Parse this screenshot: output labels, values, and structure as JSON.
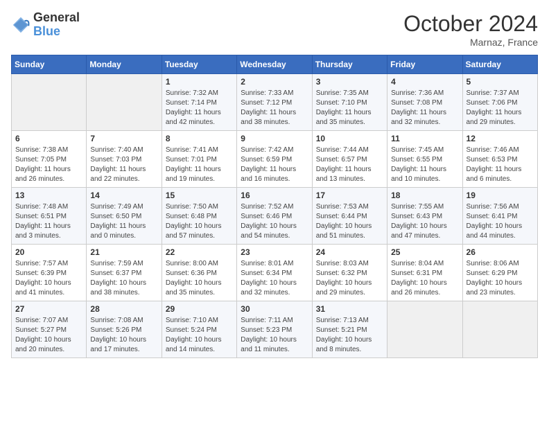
{
  "header": {
    "logo_line1": "General",
    "logo_line2": "Blue",
    "month_title": "October 2024",
    "subtitle": "Marnaz, France"
  },
  "days_of_week": [
    "Sunday",
    "Monday",
    "Tuesday",
    "Wednesday",
    "Thursday",
    "Friday",
    "Saturday"
  ],
  "weeks": [
    [
      {
        "day": "",
        "content": ""
      },
      {
        "day": "",
        "content": ""
      },
      {
        "day": "1",
        "content": "Sunrise: 7:32 AM\nSunset: 7:14 PM\nDaylight: 11 hours and 42 minutes."
      },
      {
        "day": "2",
        "content": "Sunrise: 7:33 AM\nSunset: 7:12 PM\nDaylight: 11 hours and 38 minutes."
      },
      {
        "day": "3",
        "content": "Sunrise: 7:35 AM\nSunset: 7:10 PM\nDaylight: 11 hours and 35 minutes."
      },
      {
        "day": "4",
        "content": "Sunrise: 7:36 AM\nSunset: 7:08 PM\nDaylight: 11 hours and 32 minutes."
      },
      {
        "day": "5",
        "content": "Sunrise: 7:37 AM\nSunset: 7:06 PM\nDaylight: 11 hours and 29 minutes."
      }
    ],
    [
      {
        "day": "6",
        "content": "Sunrise: 7:38 AM\nSunset: 7:05 PM\nDaylight: 11 hours and 26 minutes."
      },
      {
        "day": "7",
        "content": "Sunrise: 7:40 AM\nSunset: 7:03 PM\nDaylight: 11 hours and 22 minutes."
      },
      {
        "day": "8",
        "content": "Sunrise: 7:41 AM\nSunset: 7:01 PM\nDaylight: 11 hours and 19 minutes."
      },
      {
        "day": "9",
        "content": "Sunrise: 7:42 AM\nSunset: 6:59 PM\nDaylight: 11 hours and 16 minutes."
      },
      {
        "day": "10",
        "content": "Sunrise: 7:44 AM\nSunset: 6:57 PM\nDaylight: 11 hours and 13 minutes."
      },
      {
        "day": "11",
        "content": "Sunrise: 7:45 AM\nSunset: 6:55 PM\nDaylight: 11 hours and 10 minutes."
      },
      {
        "day": "12",
        "content": "Sunrise: 7:46 AM\nSunset: 6:53 PM\nDaylight: 11 hours and 6 minutes."
      }
    ],
    [
      {
        "day": "13",
        "content": "Sunrise: 7:48 AM\nSunset: 6:51 PM\nDaylight: 11 hours and 3 minutes."
      },
      {
        "day": "14",
        "content": "Sunrise: 7:49 AM\nSunset: 6:50 PM\nDaylight: 11 hours and 0 minutes."
      },
      {
        "day": "15",
        "content": "Sunrise: 7:50 AM\nSunset: 6:48 PM\nDaylight: 10 hours and 57 minutes."
      },
      {
        "day": "16",
        "content": "Sunrise: 7:52 AM\nSunset: 6:46 PM\nDaylight: 10 hours and 54 minutes."
      },
      {
        "day": "17",
        "content": "Sunrise: 7:53 AM\nSunset: 6:44 PM\nDaylight: 10 hours and 51 minutes."
      },
      {
        "day": "18",
        "content": "Sunrise: 7:55 AM\nSunset: 6:43 PM\nDaylight: 10 hours and 47 minutes."
      },
      {
        "day": "19",
        "content": "Sunrise: 7:56 AM\nSunset: 6:41 PM\nDaylight: 10 hours and 44 minutes."
      }
    ],
    [
      {
        "day": "20",
        "content": "Sunrise: 7:57 AM\nSunset: 6:39 PM\nDaylight: 10 hours and 41 minutes."
      },
      {
        "day": "21",
        "content": "Sunrise: 7:59 AM\nSunset: 6:37 PM\nDaylight: 10 hours and 38 minutes."
      },
      {
        "day": "22",
        "content": "Sunrise: 8:00 AM\nSunset: 6:36 PM\nDaylight: 10 hours and 35 minutes."
      },
      {
        "day": "23",
        "content": "Sunrise: 8:01 AM\nSunset: 6:34 PM\nDaylight: 10 hours and 32 minutes."
      },
      {
        "day": "24",
        "content": "Sunrise: 8:03 AM\nSunset: 6:32 PM\nDaylight: 10 hours and 29 minutes."
      },
      {
        "day": "25",
        "content": "Sunrise: 8:04 AM\nSunset: 6:31 PM\nDaylight: 10 hours and 26 minutes."
      },
      {
        "day": "26",
        "content": "Sunrise: 8:06 AM\nSunset: 6:29 PM\nDaylight: 10 hours and 23 minutes."
      }
    ],
    [
      {
        "day": "27",
        "content": "Sunrise: 7:07 AM\nSunset: 5:27 PM\nDaylight: 10 hours and 20 minutes."
      },
      {
        "day": "28",
        "content": "Sunrise: 7:08 AM\nSunset: 5:26 PM\nDaylight: 10 hours and 17 minutes."
      },
      {
        "day": "29",
        "content": "Sunrise: 7:10 AM\nSunset: 5:24 PM\nDaylight: 10 hours and 14 minutes."
      },
      {
        "day": "30",
        "content": "Sunrise: 7:11 AM\nSunset: 5:23 PM\nDaylight: 10 hours and 11 minutes."
      },
      {
        "day": "31",
        "content": "Sunrise: 7:13 AM\nSunset: 5:21 PM\nDaylight: 10 hours and 8 minutes."
      },
      {
        "day": "",
        "content": ""
      },
      {
        "day": "",
        "content": ""
      }
    ]
  ]
}
